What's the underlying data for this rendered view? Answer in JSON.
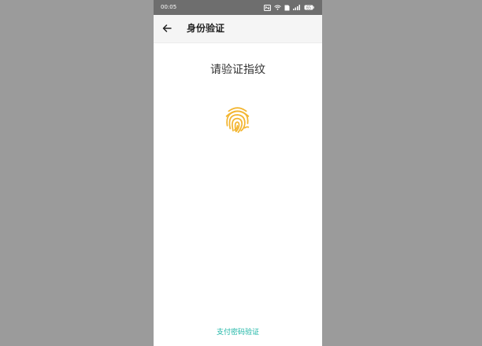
{
  "status_bar": {
    "time": "00:05",
    "icons": [
      "nfc-icon",
      "wifi-icon",
      "sim-icon",
      "signal-icon",
      "battery-icon"
    ],
    "battery": "65"
  },
  "app_bar": {
    "title": "身份验证",
    "back_icon": "arrow-left-icon"
  },
  "main": {
    "prompt": "请验证指纹",
    "fingerprint_icon": "fingerprint-icon",
    "fingerprint_color": "#f3b632",
    "pay_password_link": "支付密码验证",
    "link_color": "#1bb5a5"
  }
}
